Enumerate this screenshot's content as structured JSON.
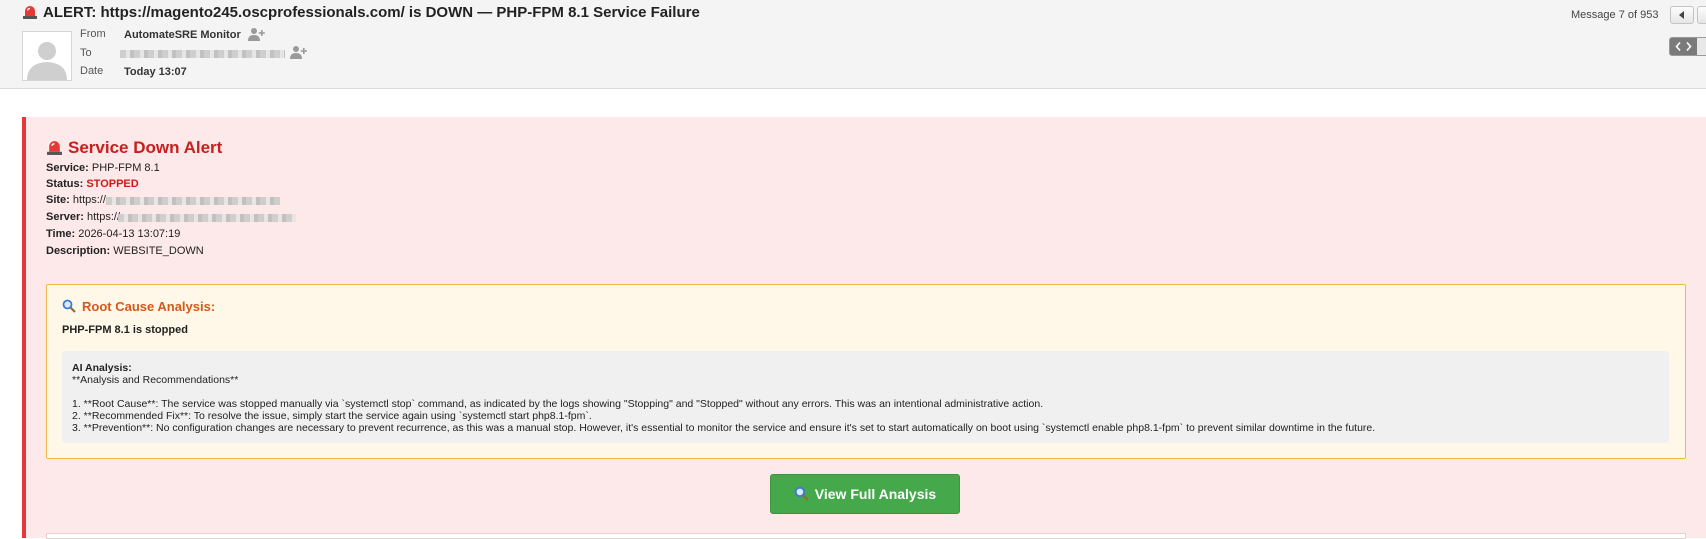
{
  "header": {
    "subject": "ALERT: https://magento245.oscprofessionals.com/ is DOWN — PHP-FPM 8.1 Service Failure",
    "from_label": "From",
    "from_value": "AutomateSRE Monitor",
    "to_label": "To",
    "date_label": "Date",
    "date_value": "Today 13:07",
    "message_count": "Message 7 of 953"
  },
  "alert": {
    "title": "Service Down Alert",
    "fields": {
      "service_label": "Service:",
      "service_value": "PHP-FPM 8.1",
      "status_label": "Status:",
      "status_value": "STOPPED",
      "site_label": "Site:",
      "site_value": "https://",
      "server_label": "Server:",
      "server_value": "https://",
      "time_label": "Time:",
      "time_value": "2026-04-13 13:07:19",
      "description_label": "Description:",
      "description_value": "WEBSITE_DOWN"
    }
  },
  "rca": {
    "title": "Root Cause Analysis:",
    "subtitle": "PHP-FPM 8.1 is stopped",
    "ai_heading": "AI Analysis:",
    "ai_intro": "**Analysis and Recommendations**",
    "items": [
      "1. **Root Cause**: The service was stopped manually via `systemctl stop` command, as indicated by the logs showing \"Stopping\" and \"Stopped\" without any errors. This was an intentional administrative action.",
      "2. **Recommended Fix**: To resolve the issue, simply start the service again using `systemctl start php8.1-fpm`.",
      "3. **Prevention**: No configuration changes are necessary to prevent recurrence, as this was a manual stop. However, it's essential to monitor the service and ensure it's set to start automatically on boot using `systemctl enable php8.1-fpm` to prevent similar downtime in the future."
    ]
  },
  "actions": {
    "view_full_analysis": "View Full Analysis"
  },
  "colors": {
    "alert_red": "#c81e1e",
    "alert_bg": "#fde9e9",
    "rca_orange": "#d4581a",
    "button_green": "#45a84a"
  },
  "icons": {
    "siren": "siren-icon",
    "magnifier": "magnifier-icon",
    "add_contact": "add-contact-icon",
    "avatar": "avatar-icon",
    "prev": "chevron-left-icon",
    "view_toggle": "code-view-icon"
  }
}
